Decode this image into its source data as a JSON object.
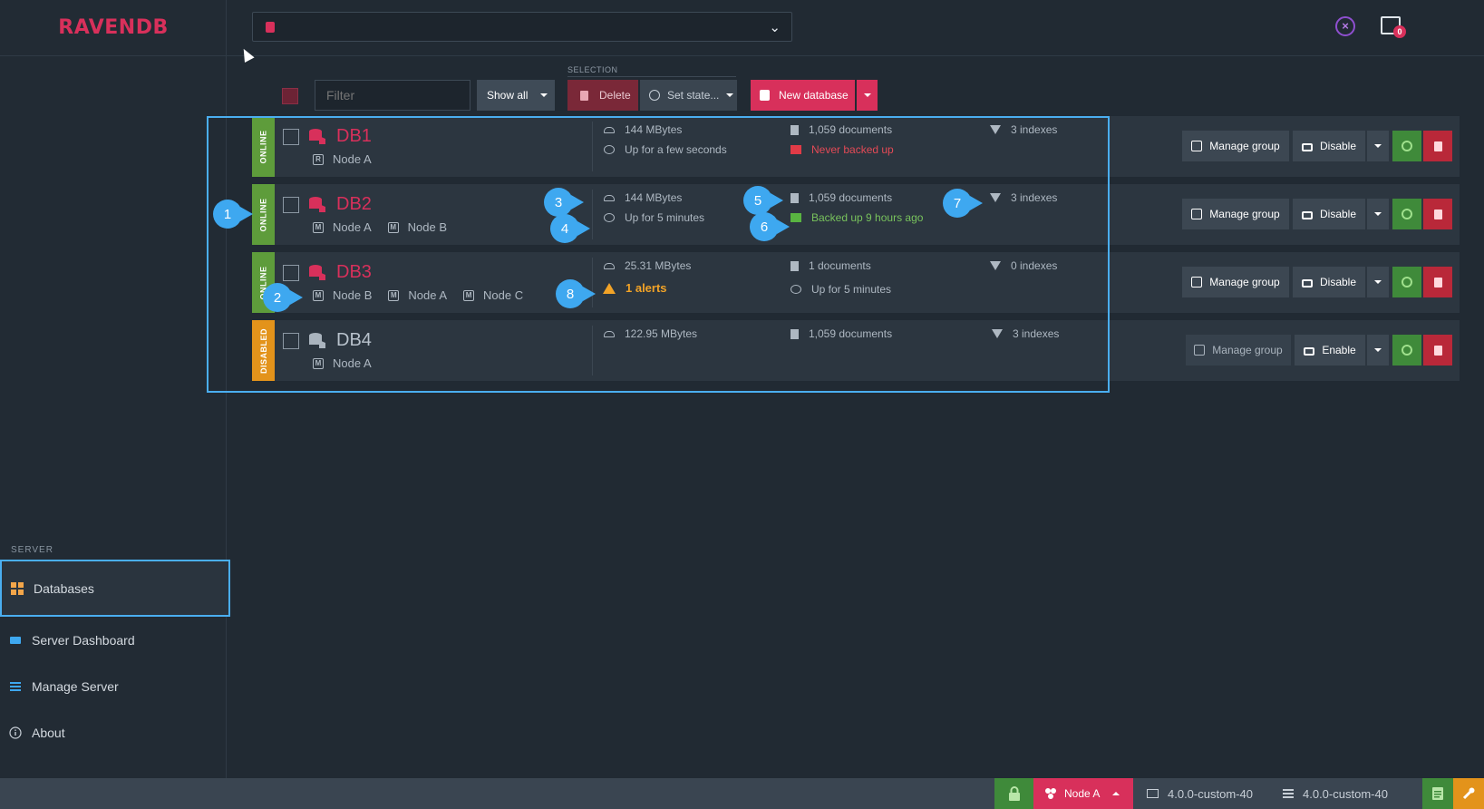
{
  "app": {
    "logo": "RAVENDB"
  },
  "toolbar": {
    "filter_placeholder": "Filter",
    "show_all": "Show all",
    "selection_label": "SELECTION",
    "delete": "Delete",
    "set_state": "Set state...",
    "new_database": "New database"
  },
  "notifications": {
    "count": "0"
  },
  "databases": [
    {
      "status": "ONLINE",
      "status_color": "#5e9c3b",
      "name": "DB1",
      "nodes": [
        {
          "tag": "R",
          "label": "Node A"
        }
      ],
      "size": "144 MBytes",
      "uptime": "Up for a few seconds",
      "documents": "1,059 documents",
      "backup": "Never backed up",
      "indexes": "3 indexes",
      "manage": "Manage group",
      "toggle": "Disable"
    },
    {
      "status": "ONLINE",
      "status_color": "#5e9c3b",
      "name": "DB2",
      "nodes": [
        {
          "tag": "M",
          "label": "Node A"
        },
        {
          "tag": "M",
          "label": "Node B"
        }
      ],
      "size": "144 MBytes",
      "uptime": "Up for 5 minutes",
      "documents": "1,059 documents",
      "backup": "Backed up 9 hours ago",
      "indexes": "3 indexes",
      "manage": "Manage group",
      "toggle": "Disable"
    },
    {
      "status": "ONLINE",
      "status_color": "#5e9c3b",
      "name": "DB3",
      "nodes": [
        {
          "tag": "M",
          "label": "Node B"
        },
        {
          "tag": "M",
          "label": "Node A"
        },
        {
          "tag": "M",
          "label": "Node C"
        }
      ],
      "size": "25.31 MBytes",
      "alerts": "1 alerts",
      "documents": "1 documents",
      "uptime": "Up for 5 minutes",
      "indexes": "0 indexes",
      "manage": "Manage group",
      "toggle": "Disable"
    },
    {
      "status": "DISABLED",
      "status_color": "#e3931b",
      "name": "DB4",
      "nodes": [
        {
          "tag": "M",
          "label": "Node A"
        }
      ],
      "size": "122.95 MBytes",
      "documents": "1,059 documents",
      "indexes": "3 indexes",
      "manage": "Manage group",
      "toggle": "Enable"
    }
  ],
  "markers": [
    "1",
    "2",
    "3",
    "4",
    "5",
    "6",
    "7",
    "8"
  ],
  "sidebar": {
    "section": "SERVER",
    "items": [
      {
        "label": "Databases",
        "icon": "grid-icon"
      },
      {
        "label": "Server Dashboard",
        "icon": "dashboard-icon"
      },
      {
        "label": "Manage Server",
        "icon": "settings-icon"
      },
      {
        "label": "About",
        "icon": "info-icon"
      }
    ]
  },
  "footer": {
    "node": "Node A",
    "version_client": "4.0.0-custom-40",
    "version_server": "4.0.0-custom-40"
  },
  "colors": {
    "accent": "#d8305b",
    "highlight": "#4aaef0",
    "success": "#3f8a3a",
    "warning": "#e3931b"
  }
}
